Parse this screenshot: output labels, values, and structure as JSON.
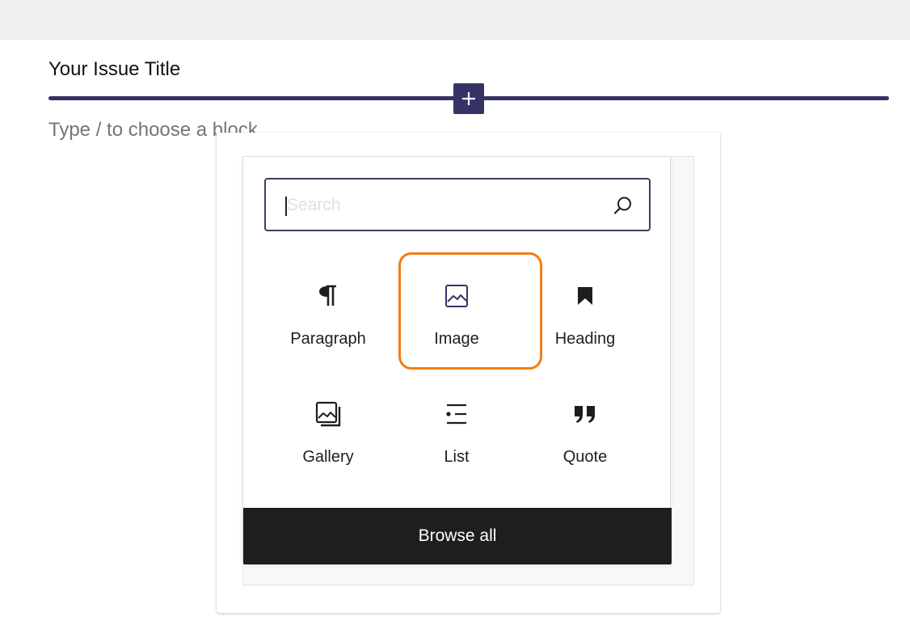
{
  "editor": {
    "title": "Your Issue Title",
    "block_placeholder": "Type / to choose a block",
    "add_block_icon": "plus-icon"
  },
  "inserter": {
    "search": {
      "value": "",
      "placeholder": "Search",
      "icon": "search-icon"
    },
    "blocks": [
      {
        "label": "Paragraph",
        "icon": "paragraph-icon"
      },
      {
        "label": "Image",
        "icon": "image-icon",
        "highlighted": true
      },
      {
        "label": "Heading",
        "icon": "bookmark-icon"
      },
      {
        "label": "Gallery",
        "icon": "gallery-icon"
      },
      {
        "label": "List",
        "icon": "list-icon"
      },
      {
        "label": "Quote",
        "icon": "quote-icon"
      }
    ],
    "browse_all_label": "Browse all"
  },
  "colors": {
    "accent": "#333366",
    "highlight": "#f57c13",
    "browse_bg": "#1e1e1e"
  }
}
